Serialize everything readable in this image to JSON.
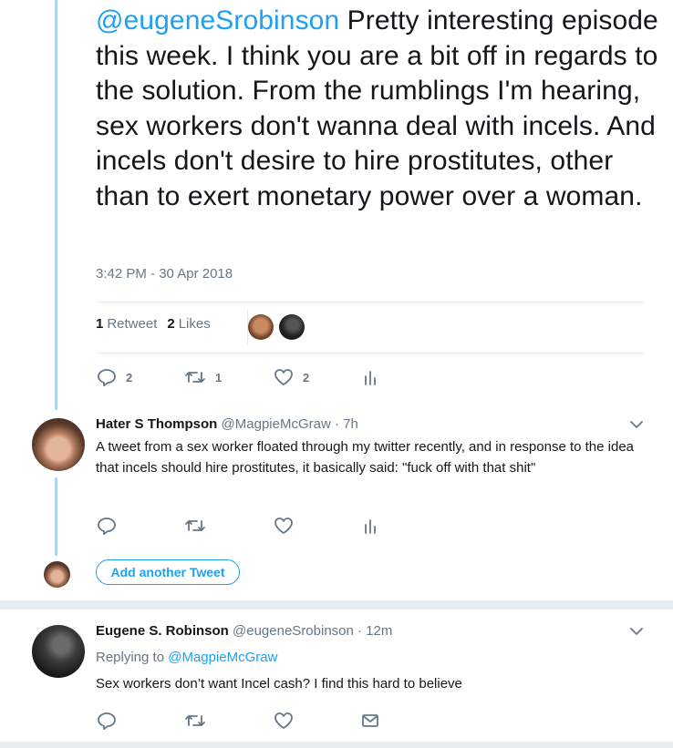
{
  "main_tweet": {
    "mention": "@eugeneSrobinson",
    "text": " Pretty interesting episode this week. I think you are a bit off in regards to the solution. From the rumblings I'm hearing, sex workers don't wanna deal with incels. And incels don't desire to hire prostitutes, other than to exert monetary power over a woman.",
    "timestamp": "3:42 PM - 30 Apr 2018",
    "retweets_count": "1",
    "retweets_label": "Retweet",
    "likes_count": "2",
    "likes_label": "Likes",
    "reply_count": "2",
    "retweet_count": "1",
    "like_count": "2"
  },
  "reply1": {
    "name": "Hater S Thompson",
    "handle": "@MagpieMcGraw",
    "time": "· 7h",
    "text": "A tweet from a sex worker floated through my twitter recently, and in response to the idea that incels should hire prostitutes, it basically said: \"fuck off with that shit\""
  },
  "composer": {
    "add_label": "Add another Tweet"
  },
  "reply2": {
    "name": "Eugene S. Robinson",
    "handle": "@eugeneSrobinson",
    "time": "· 12m",
    "replying_prefix": "Replying to ",
    "replying_to": "@MagpieMcGraw",
    "text": "Sex workers don’t want Incel cash? I find this hard to believe"
  },
  "icons": {
    "reply": "reply-icon",
    "retweet": "retweet-icon",
    "like": "heart-icon",
    "analytics": "analytics-icon",
    "dm": "envelope-icon",
    "more": "chevron-down-icon"
  },
  "colors": {
    "accent": "#1da1f2",
    "muted": "#657786",
    "thread_line": "#a8d5f5"
  }
}
